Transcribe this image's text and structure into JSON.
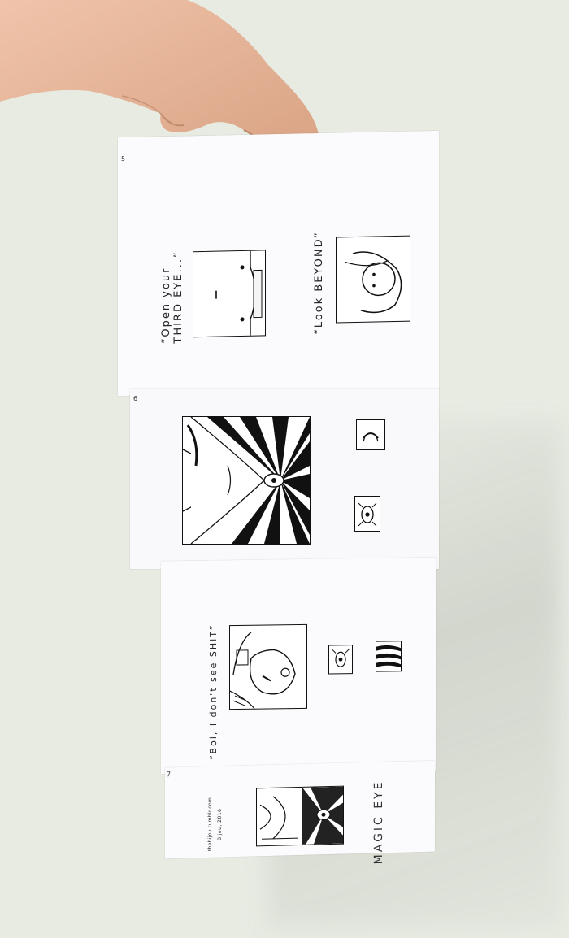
{
  "zine": {
    "page5": {
      "number": "5",
      "caption_top": "“Look BEYOND”",
      "caption_bottom": "“Open your THIRD EYE...”"
    },
    "page6": {
      "number": "6"
    },
    "page7_panel_caption": "“Boi, I don't see SHIT”",
    "back_cover": {
      "number": "7",
      "title": "MAGIC EYE",
      "credit_line1": "Bijou, 2016",
      "credit_line2": "thebijou.tumblr.com"
    }
  },
  "colors": {
    "wall": "#e7ebe2",
    "paper": "#fbfbfd",
    "ink": "#111111",
    "skin": "#e9b69b"
  }
}
